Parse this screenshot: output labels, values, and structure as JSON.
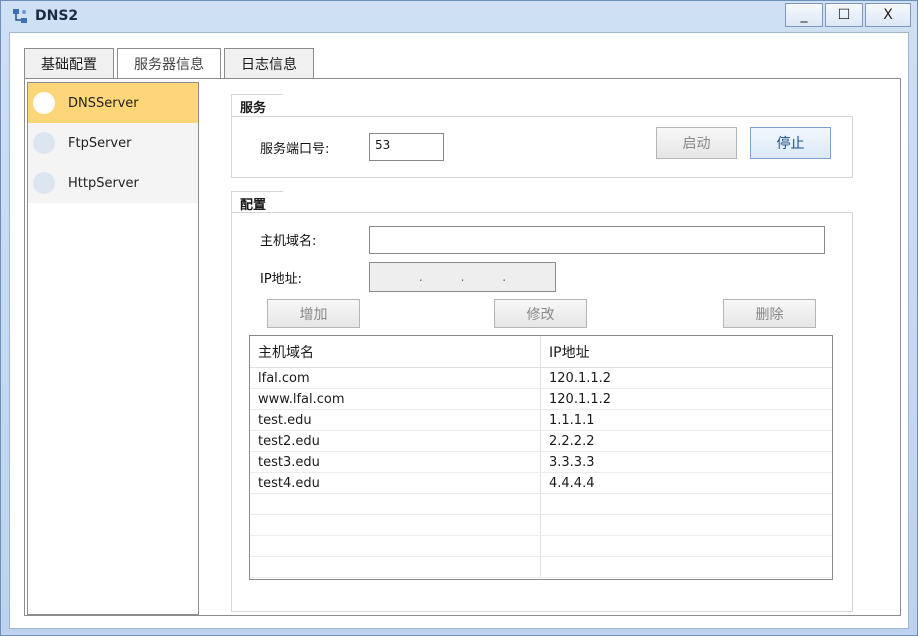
{
  "window": {
    "title": "DNS2",
    "controls": {
      "minimize": "_",
      "maximize": "☐",
      "close": "X"
    }
  },
  "tabs": [
    {
      "label": "基础配置",
      "active": false
    },
    {
      "label": "服务器信息",
      "active": true
    },
    {
      "label": "日志信息",
      "active": false
    }
  ],
  "servers": [
    {
      "label": "DNSServer",
      "selected": true
    },
    {
      "label": "FtpServer",
      "selected": false
    },
    {
      "label": "HttpServer",
      "selected": false
    }
  ],
  "service": {
    "group_title": "服务",
    "port_label": "服务端口号:",
    "port_value": "53",
    "start_label": "启动",
    "stop_label": "停止"
  },
  "config": {
    "group_title": "配置",
    "host_label": "主机域名:",
    "host_value": "",
    "ip_label": "IP地址:",
    "ip_dots": [
      ".",
      ".",
      "."
    ],
    "add_label": "增加",
    "modify_label": "修改",
    "delete_label": "删除"
  },
  "table": {
    "headers": [
      "主机域名",
      "IP地址"
    ],
    "rows": [
      [
        "lfal.com",
        "120.1.1.2"
      ],
      [
        "www.lfal.com",
        "120.1.1.2"
      ],
      [
        "test.edu",
        "1.1.1.1"
      ],
      [
        "test2.edu",
        "2.2.2.2"
      ],
      [
        "test3.edu",
        "3.3.3.3"
      ],
      [
        "test4.edu",
        "4.4.4.4"
      ],
      [
        "",
        ""
      ],
      [
        "",
        ""
      ],
      [
        "",
        ""
      ],
      [
        "",
        ""
      ]
    ]
  },
  "colors": {
    "selected_server": "#fdd67a",
    "title_bar": "#cfe0f4"
  }
}
